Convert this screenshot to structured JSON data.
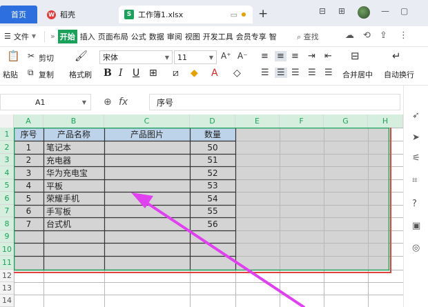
{
  "tabs": {
    "home": "首页",
    "wps": "稻壳",
    "doc": "工作簿1.xlsx",
    "new": "+"
  },
  "window": {
    "layout_icon": "layout-icon",
    "minimize": "—",
    "restore": "▢"
  },
  "menu": {
    "file": "文件",
    "items": [
      "开始",
      "插入",
      "页面布局",
      "公式",
      "数据",
      "审阅",
      "视图",
      "开发工具",
      "会员专享",
      "智"
    ],
    "search": "查找"
  },
  "ribbon": {
    "paste": "粘贴",
    "cut": "剪切",
    "copy": "复制",
    "format_painter": "格式刷",
    "font_name": "宋体",
    "font_size": "11",
    "merge": "合并居中",
    "wrap": "自动换行"
  },
  "formula": {
    "cell_ref": "A1",
    "fx": "fx",
    "content": "序号"
  },
  "columns": [
    "A",
    "B",
    "C",
    "D",
    "E",
    "F",
    "G",
    "H"
  ],
  "rows": [
    "1",
    "2",
    "3",
    "4",
    "5",
    "6",
    "7",
    "8",
    "9",
    "10",
    "11",
    "12",
    "13",
    "14"
  ],
  "table": {
    "headers": [
      "序号",
      "产品名称",
      "产品图片",
      "数量"
    ],
    "data": [
      [
        "1",
        "笔记本",
        "",
        "50"
      ],
      [
        "2",
        "充电器",
        "",
        "51"
      ],
      [
        "3",
        "华为充电宝",
        "",
        "52"
      ],
      [
        "4",
        "平板",
        "",
        "53"
      ],
      [
        "5",
        "荣耀手机",
        "",
        "54"
      ],
      [
        "6",
        "手写板",
        "",
        "55"
      ],
      [
        "7",
        "台式机",
        "",
        "56"
      ]
    ]
  },
  "colors": {
    "accent": "#1aa25a",
    "selection_border": "#e0413b",
    "arrow": "#e040f0",
    "header_fill": "#bcd3ea"
  }
}
